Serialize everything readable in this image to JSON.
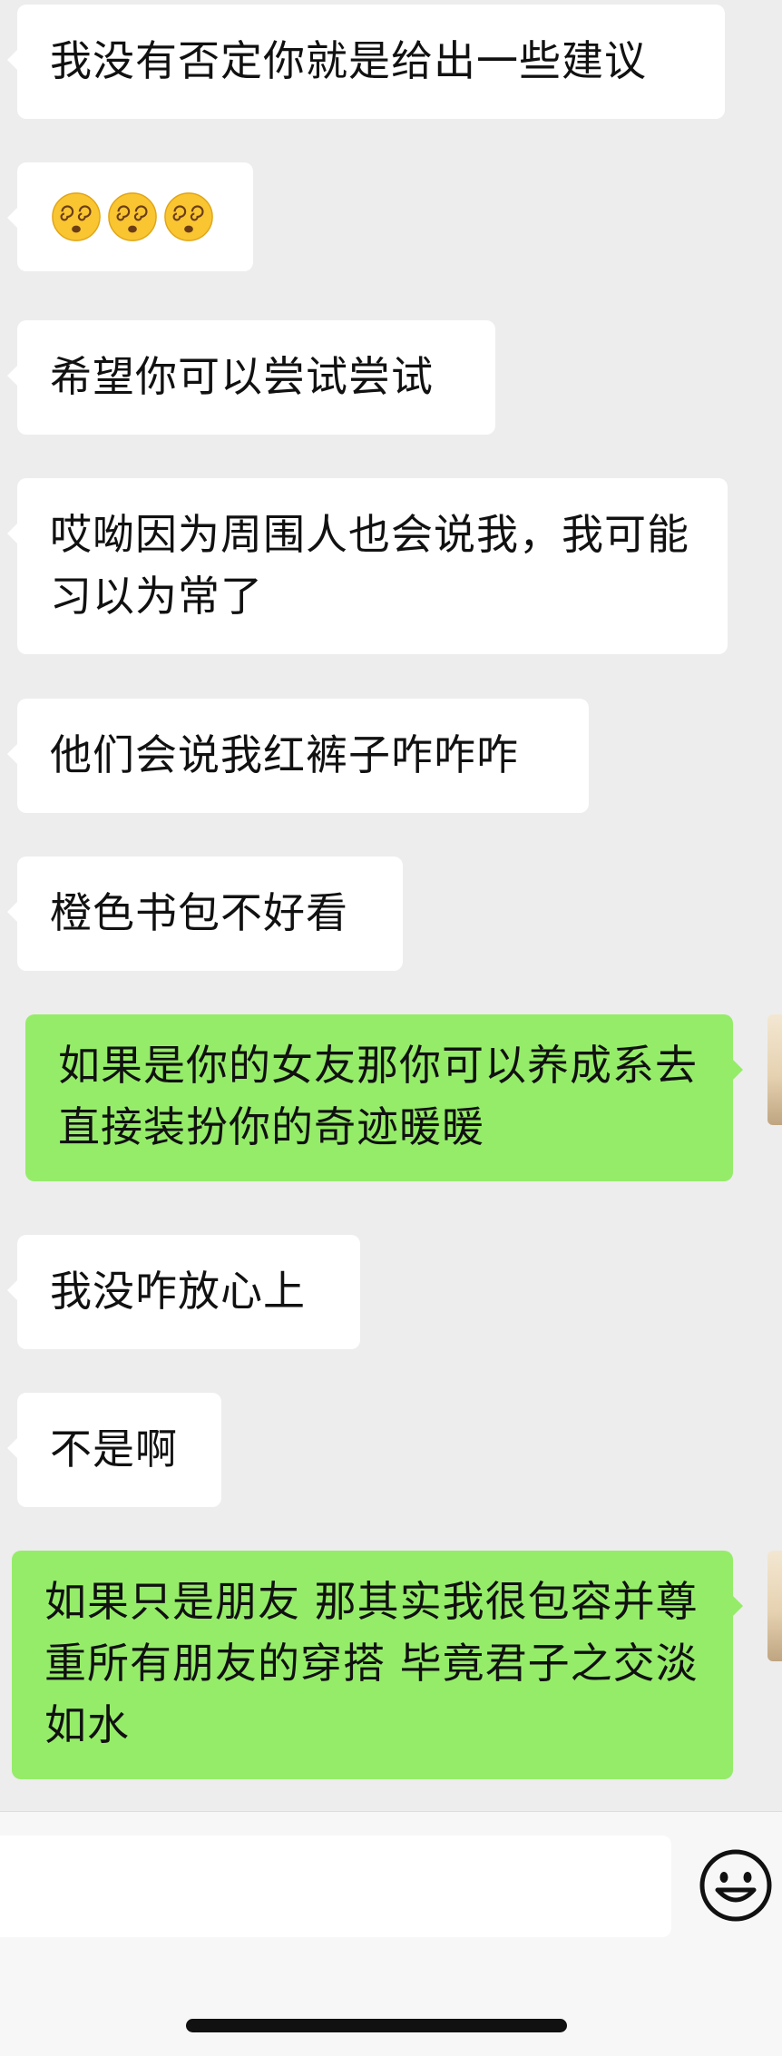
{
  "messages": [
    {
      "side": "in",
      "text": "我没有否定你就是给出一些建议"
    },
    {
      "side": "in",
      "emoji": "dizzy-face-emoji",
      "count": 3
    },
    {
      "side": "in",
      "text": "希望你可以尝试尝试"
    },
    {
      "side": "in",
      "text": "哎呦因为周围人也会说我，我可能习以为常了"
    },
    {
      "side": "in",
      "text": "他们会说我红裤子咋咋咋"
    },
    {
      "side": "in",
      "text": "橙色书包不好看"
    },
    {
      "side": "out",
      "text": "如果是你的女友那你可以养成系去直接装扮你的奇迹暖暖"
    },
    {
      "side": "in",
      "text": "我没咋放心上"
    },
    {
      "side": "in",
      "text": "不是啊"
    },
    {
      "side": "out",
      "text": "如果只是朋友 那其实我很包容并尊重所有朋友的穿搭 毕竟君子之交淡如水"
    }
  ],
  "input_bar": {
    "input_value": "",
    "emoji_icon": "smiley-face-icon"
  },
  "colors": {
    "chat_background": "#ededed",
    "incoming_bubble": "#ffffff",
    "outgoing_bubble": "#95ec69",
    "text": "#111111"
  }
}
